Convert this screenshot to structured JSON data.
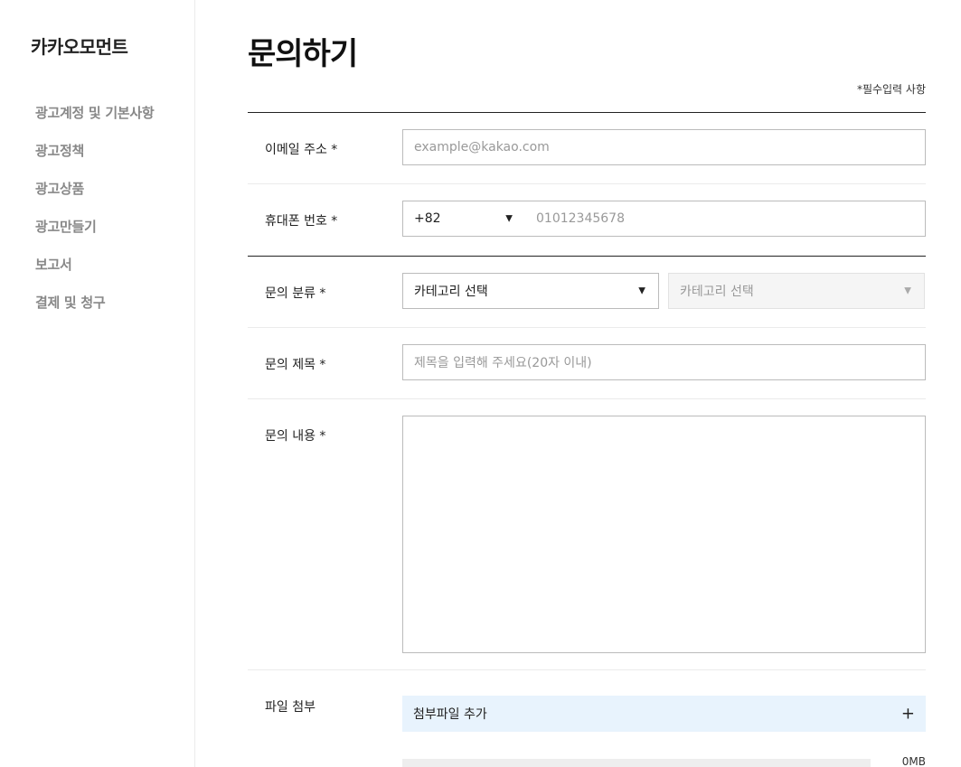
{
  "sidebar": {
    "brand": "카카오모먼트",
    "items": [
      {
        "label": "광고계정 및 기본사항"
      },
      {
        "label": "광고정책"
      },
      {
        "label": "광고상품"
      },
      {
        "label": "광고만들기"
      },
      {
        "label": "보고서"
      },
      {
        "label": "결제 및 청구"
      }
    ]
  },
  "page": {
    "title": "문의하기",
    "required_note": "*필수입력 사항"
  },
  "form": {
    "email": {
      "label": "이메일 주소 *",
      "value": "",
      "placeholder": "example@kakao.com"
    },
    "phone": {
      "label": "휴대폰 번호 *",
      "country_code": "+82",
      "value": "",
      "placeholder": "01012345678"
    },
    "category": {
      "label": "문의 분류 *",
      "primary": "카테고리 선택",
      "secondary": "카테고리 선택"
    },
    "subject": {
      "label": "문의 제목 *",
      "value": "",
      "placeholder": "제목을 입력해 주세요(20자 이내)"
    },
    "content": {
      "label": "문의 내용 *",
      "value": ""
    },
    "attachment": {
      "label": "파일 첨부",
      "button_label": "첨부파일 추가",
      "used_fraction": 0,
      "size_text": "0MB"
    }
  },
  "icons": {
    "caret": "▼",
    "plus": "+"
  },
  "colors": {
    "attach_bg": "#e8f3fd",
    "sidebar_text": "#888888"
  }
}
